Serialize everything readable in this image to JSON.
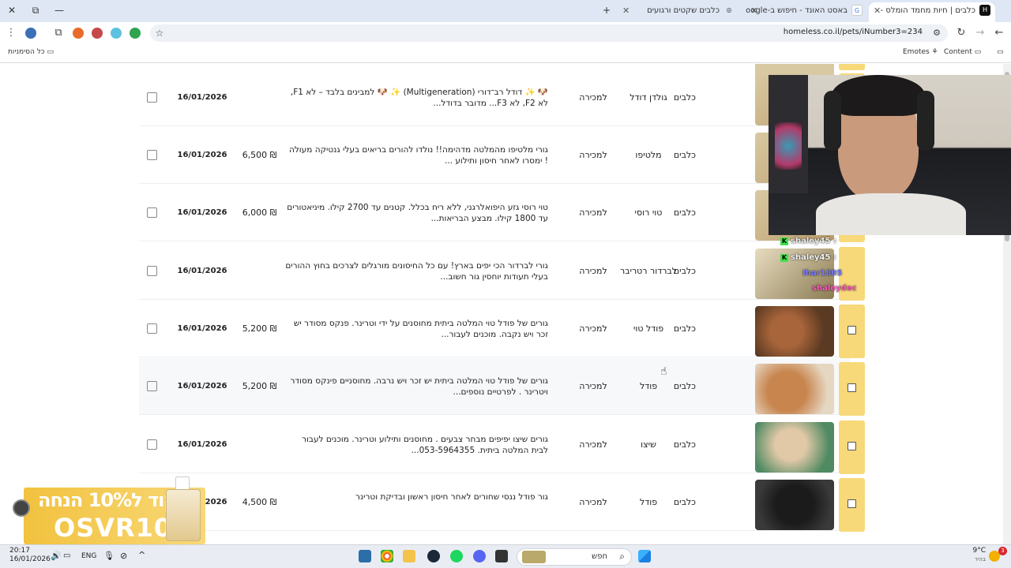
{
  "window": {
    "close": "✕",
    "maximize": "⧉",
    "minimize": "—"
  },
  "tabs": [
    {
      "title": "כלבים | חיות מחמד הומלס -",
      "fav": "H",
      "active": true
    },
    {
      "title": "באסט האונד - חיפוש ב-Google",
      "fav": "G",
      "active": false
    },
    {
      "title": "כלבים שקטים ורגועים",
      "fav": "◎",
      "active": false
    }
  ],
  "new_tab": "+",
  "toolbar": {
    "url": "homeless.co.il/pets/iNumber3=234"
  },
  "bookmarks": {
    "all": "כל הסימניות",
    "content": "Content",
    "emotes": "Emotes"
  },
  "rows": [
    {
      "category": "כלבים",
      "breed": "גולדן דודל",
      "type": "למכירה",
      "desc": "🐶 ✨ דודל רב־דורי (Multigeneration) ✨ 🐶 למבינים בלבד – לא F1, לא F2, לא F3... מדובר בדודל...",
      "price": "",
      "date": "16/01/2026",
      "thumb": "dog"
    },
    {
      "category": "כלבים",
      "breed": "מלטיפו",
      "type": "למכירה",
      "desc": "גורי מלטיפו מהמלטה מדהימה!! נולדו להורים בריאים בעלי גנטיקה מעולה ! ימסרו לאחר חיסון ותילוע ...",
      "price": "6,500 ₪",
      "date": "16/01/2026",
      "thumb": "dog"
    },
    {
      "category": "כלבים",
      "breed": "טוי רוסי",
      "type": "למכירה",
      "desc": "טוי רוסי גזע היפואלרגני, ללא ריח בכלל. קטנים עד 2700 קילו. מיניאטורים עד 1800 קילו. מבצע הבריאות...",
      "price": "6,000 ₪",
      "date": "16/01/2026",
      "thumb": "dog"
    },
    {
      "category": "כלבים",
      "breed": "לברדור רטריבר",
      "type": "למכירה",
      "desc": "גורי לברדור הכי יפים בארץ! עם כל החיסונים מורגלים לצרכים בחוץ ההורים בעלי תעודות יוחסין גור חשוב...",
      "price": "",
      "date": "16/01/2026",
      "thumb": "lab"
    },
    {
      "category": "כלבים",
      "breed": "פודל טוי",
      "type": "למכירה",
      "desc": "גורים של פודל טוי המלטה ביתית מחוסנים על ידי וטרינר. פנקס מסודר יש זכר ויש נקבה. מוכנים לעבור...",
      "price": "5,200 ₪",
      "date": "16/01/2026",
      "thumb": "poodle"
    },
    {
      "category": "כלבים",
      "breed": "פודל",
      "type": "למכירה",
      "desc": "גורים של פודל טוי המלטה ביתית יש זכר ויש נרבה. מחוסניים פינקס מסודר ויטרינר . לפרטיים נוספים...",
      "price": "5,200 ₪",
      "date": "16/01/2026",
      "thumb": "poodle2"
    },
    {
      "category": "כלבים",
      "breed": "שיצו",
      "type": "למכירה",
      "desc": "גורים שיצו יפיפים מבחר צבעים . מחוסנים ותילוע וטרינר. מוכנים לעבור לבית המלטה ביתית. 053-5964355...",
      "price": "",
      "date": "16/01/2026",
      "thumb": "shih"
    },
    {
      "category": "כלבים",
      "breed": "פודל",
      "type": "למכירה",
      "desc": "גור פודל ננסי שחורים לאחר חיסון ראשון ובדיקת וטרינר",
      "price": "4,500 ₪",
      "date": "16/01/2026",
      "thumb": "black"
    }
  ],
  "chat": [
    {
      "user": "shaley45 :",
      "color": "#e8e8e8"
    },
    {
      "user": "shaley45 :",
      "color": "#e8e8e8"
    },
    {
      "user": "Ihar1805",
      "color": "#7b7bff"
    },
    {
      "user": "shaleydec",
      "color": "#ff5bbd"
    }
  ],
  "promo": {
    "line1": "קוד ל10% הנחה",
    "line2": "OSVR10"
  },
  "taskbar": {
    "time": "20:17",
    "date": "16/01/2026",
    "lang": "ENG",
    "search": "חפש",
    "weather_temp": "9°C",
    "weather_desc": "בהיר",
    "badge": "3"
  }
}
